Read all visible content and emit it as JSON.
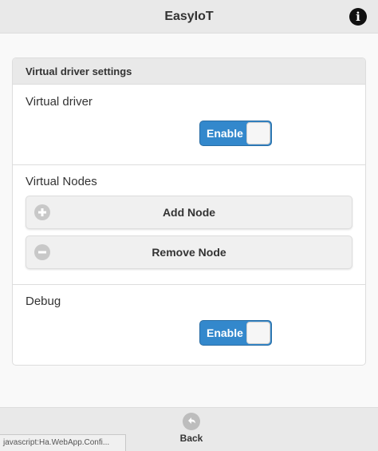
{
  "header": {
    "title": "EasyIoT",
    "info_icon": "info-circle-icon",
    "info_glyph": "i"
  },
  "panel": {
    "title": "Virtual driver settings",
    "virtual_driver": {
      "label": "Virtual driver",
      "toggle_label": "Enable",
      "toggle_on": true
    },
    "virtual_nodes": {
      "label": "Virtual Nodes",
      "add_button": "Add Node",
      "add_icon": "plus-circle-icon",
      "remove_button": "Remove Node",
      "remove_icon": "minus-circle-icon"
    },
    "debug": {
      "label": "Debug",
      "toggle_label": "Enable",
      "toggle_on": true
    }
  },
  "footer": {
    "back_label": "Back",
    "back_icon": "back-arrow-icon"
  },
  "status_bar": {
    "text": "javascript:Ha.WebApp.Confi..."
  },
  "colors": {
    "accent": "#3388cc",
    "header_bg": "#e9e9e9",
    "page_bg": "#f9f9f9"
  }
}
